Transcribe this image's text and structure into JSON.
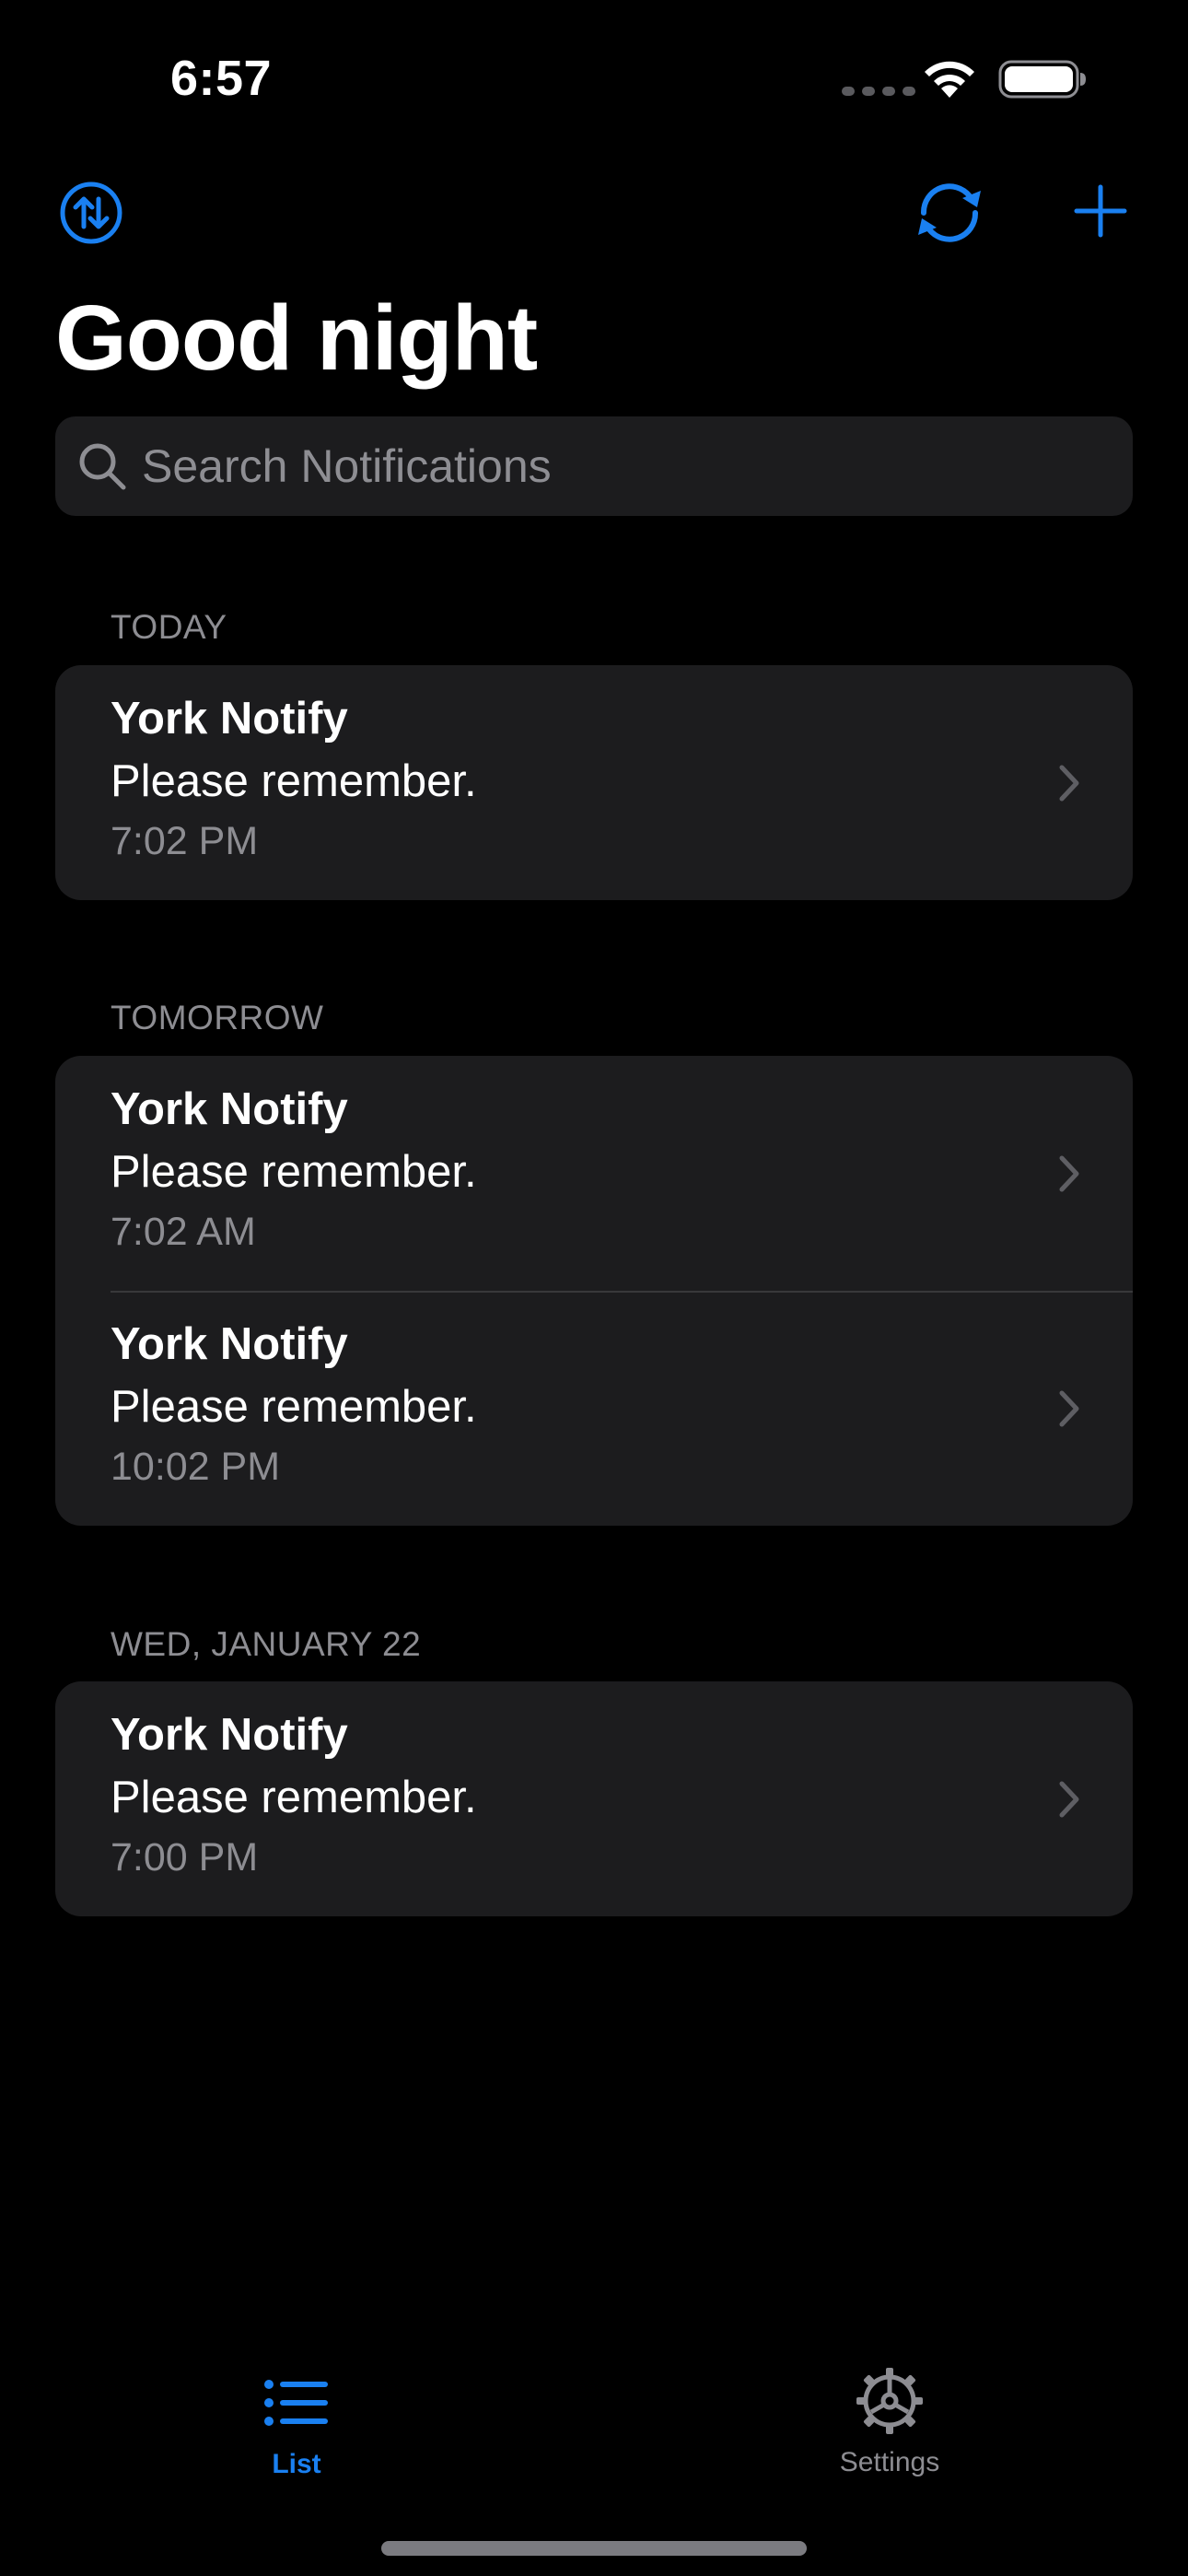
{
  "status_bar": {
    "time": "6:57"
  },
  "toolbar": {
    "sort_icon": "arrow-up-down-circle-icon",
    "refresh_icon": "refresh-icon",
    "add_icon": "plus-icon"
  },
  "page": {
    "title": "Good night"
  },
  "search": {
    "placeholder": "Search Notifications"
  },
  "sections": [
    {
      "header": "TODAY",
      "items": [
        {
          "title": "York Notify",
          "body": "Please remember.",
          "time": "7:02 PM"
        }
      ]
    },
    {
      "header": "TOMORROW",
      "items": [
        {
          "title": "York Notify",
          "body": "Please remember.",
          "time": "7:02 AM"
        },
        {
          "title": "York Notify",
          "body": "Please remember.",
          "time": "10:02 PM"
        }
      ]
    },
    {
      "header": "WED, JANUARY 22",
      "items": [
        {
          "title": "York Notify",
          "body": "Please remember.",
          "time": "7:00 PM"
        }
      ]
    }
  ],
  "tab_bar": {
    "tabs": [
      {
        "label": "List",
        "icon": "list-icon",
        "selected": true
      },
      {
        "label": "Settings",
        "icon": "gear-icon",
        "selected": false
      }
    ]
  },
  "colors": {
    "accent": "#1a80f1",
    "background": "#000000",
    "card": "#1c1c1e",
    "secondary_text": "#8d8d92"
  }
}
